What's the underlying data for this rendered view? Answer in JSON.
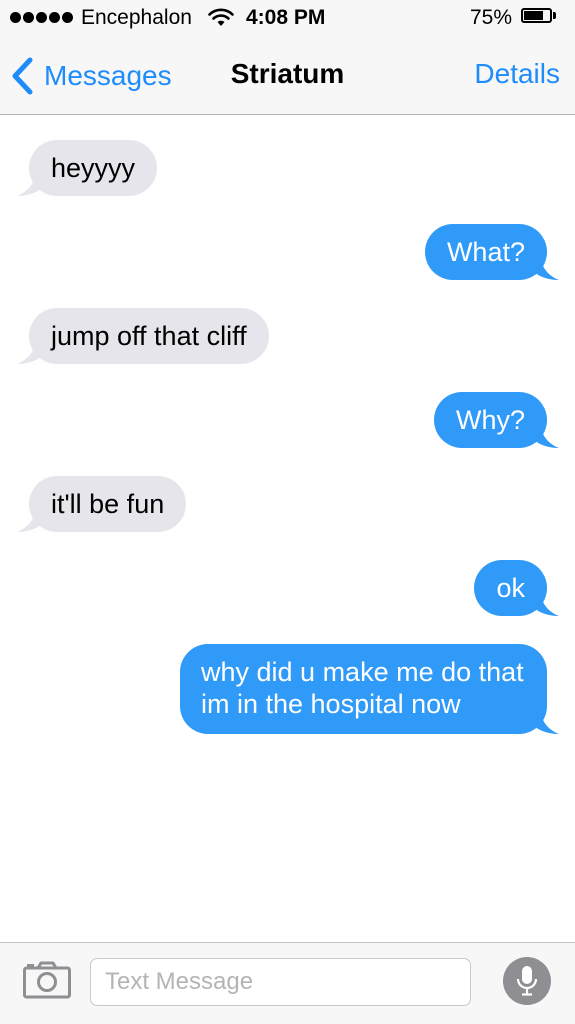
{
  "status_bar": {
    "carrier": "Encephalon",
    "time": "4:08 PM",
    "battery_percent": "75%",
    "battery_level": 0.75,
    "signal_bars": 5,
    "icons": [
      "signal-dots-icon",
      "wifi-icon",
      "battery-icon"
    ]
  },
  "nav": {
    "back_label": "Messages",
    "title": "Striatum",
    "details_label": "Details"
  },
  "messages": [
    {
      "from": "them",
      "text": "heyyyy"
    },
    {
      "from": "me",
      "text": "What?"
    },
    {
      "from": "them",
      "text": "jump off that cliff"
    },
    {
      "from": "me",
      "text": "Why?"
    },
    {
      "from": "them",
      "text": "it'll be fun"
    },
    {
      "from": "me",
      "text": "ok"
    },
    {
      "from": "me",
      "text": "why did u make me do that im in the hospital now"
    }
  ],
  "input_bar": {
    "placeholder": "Text Message",
    "value": "",
    "icons": [
      "camera-icon",
      "microphone-icon"
    ]
  },
  "colors": {
    "accent": "#1e8cfa",
    "outgoing_bubble": "#2f9af7",
    "incoming_bubble": "#e6e5eb",
    "bar_background": "#f7f7f7"
  }
}
